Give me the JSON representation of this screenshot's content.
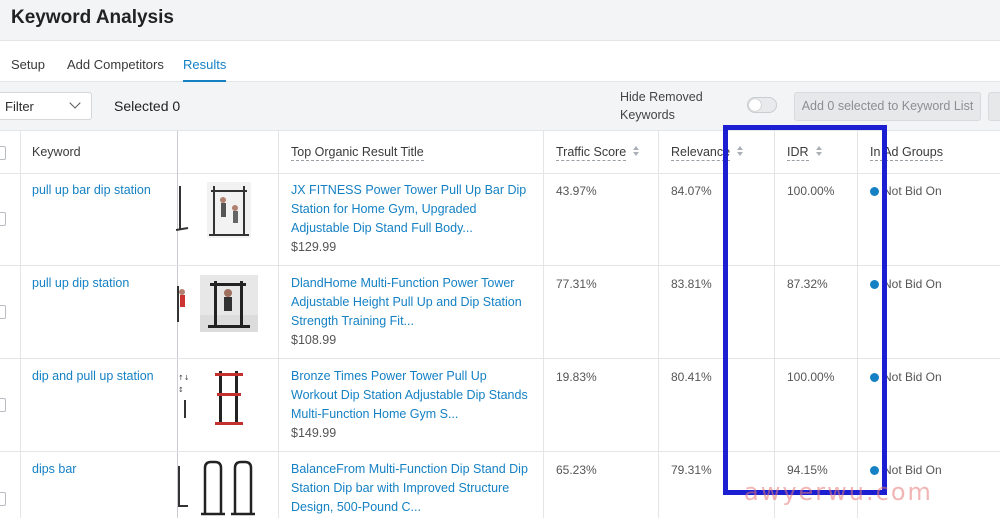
{
  "app": {
    "title": "Keyword Analysis"
  },
  "tabs": [
    {
      "label": "Setup"
    },
    {
      "label": "Add Competitors"
    },
    {
      "label": "Results"
    }
  ],
  "active_tab": "Results",
  "toolbar": {
    "filter_label": "Filter",
    "selected_text": "Selected 0",
    "hide_removed_label": "Hide Removed Keywords",
    "hide_removed_on": false,
    "add_button_label": "Add 0 selected to Keyword List"
  },
  "table": {
    "columns": {
      "keyword": "Keyword",
      "title": "Top Organic Result Title",
      "traffic": "Traffic Score",
      "relevance": "Relevance",
      "idr": "IDR",
      "ad_groups": "In Ad Groups"
    },
    "rows": [
      {
        "keyword": "pull up bar dip station",
        "title": "JX FITNESS Power Tower Pull Up Bar Dip Station for Home Gym, Upgraded Adjustable Dip Stand Full Body...",
        "price": "$129.99",
        "traffic": "43.97%",
        "relevance": "84.07%",
        "idr": "100.00%",
        "ad_groups": "Not Bid On"
      },
      {
        "keyword": "pull up dip station",
        "title": "DlandHome Multi-Function Power Tower Adjustable Height Pull Up and Dip Station Strength Training Fit...",
        "price": "$108.99",
        "traffic": "77.31%",
        "relevance": "83.81%",
        "idr": "87.32%",
        "ad_groups": "Not Bid On"
      },
      {
        "keyword": "dip and pull up station",
        "title": "Bronze Times Power Tower Pull Up Workout Dip Station Adjustable Dip Stands Multi-Function Home Gym S...",
        "price": "$149.99",
        "traffic": "19.83%",
        "relevance": "80.41%",
        "idr": "100.00%",
        "ad_groups": "Not Bid On"
      },
      {
        "keyword": "dips bar",
        "title": "BalanceFrom Multi-Function Dip Stand Dip Station Dip bar with Improved Structure Design, 500-Pound C...",
        "price": "",
        "traffic": "65.23%",
        "relevance": "79.31%",
        "idr": "94.15%",
        "ad_groups": "Not Bid On"
      }
    ]
  },
  "watermark": "awyerwu.com",
  "colors": {
    "accent": "#1581c4",
    "highlight_box": "#1b1fd1",
    "header_bg": "#f3f4f5"
  }
}
